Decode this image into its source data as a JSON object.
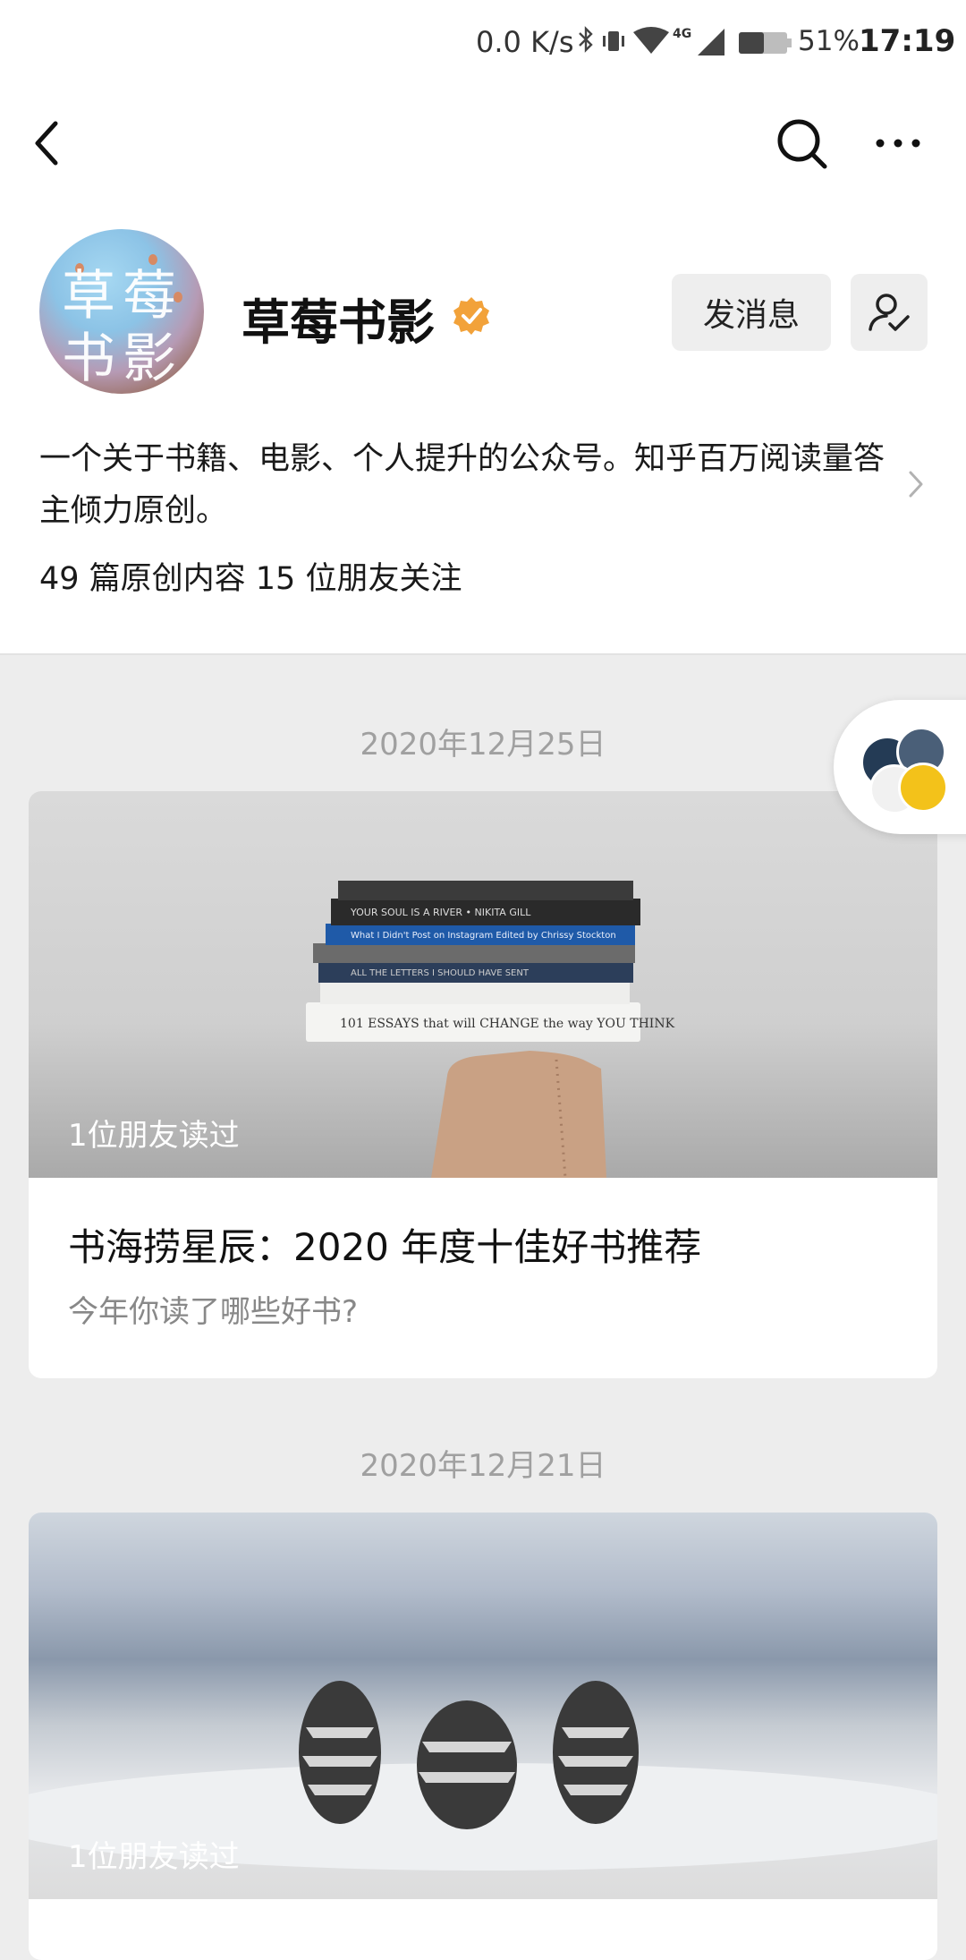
{
  "status_bar": {
    "network_speed": "0.0 K/s",
    "lte": "4G",
    "battery_percent": "51%",
    "time": "17:19"
  },
  "nav": {
    "back_icon": "chevron-left-icon",
    "search_icon": "search-icon",
    "more_icon": "more-dots-icon"
  },
  "profile": {
    "avatar_text_line1": "草莓",
    "avatar_text_line2": "书影",
    "name": "草莓书影",
    "verified_icon": "verified-badge-icon",
    "verified_color": "#f2a23a",
    "message_button": "发消息",
    "follow_icon": "user-check-icon",
    "description": "一个关于书籍、电影、个人提升的公众号。知乎百万阅读量答主倾力原创。",
    "stats": "49 篇原创内容  15 位朋友关注"
  },
  "feed": [
    {
      "date": "2020年12月25日",
      "read_by": "1位朋友读过",
      "title": "书海捞星辰：2020 年度十佳好书推荐",
      "subtitle": "今年你读了哪些好书?"
    },
    {
      "date": "2020年12月21日",
      "read_by": "1位朋友读过"
    }
  ],
  "floating_tab": {
    "icon": "stacked-avatars-icon"
  }
}
